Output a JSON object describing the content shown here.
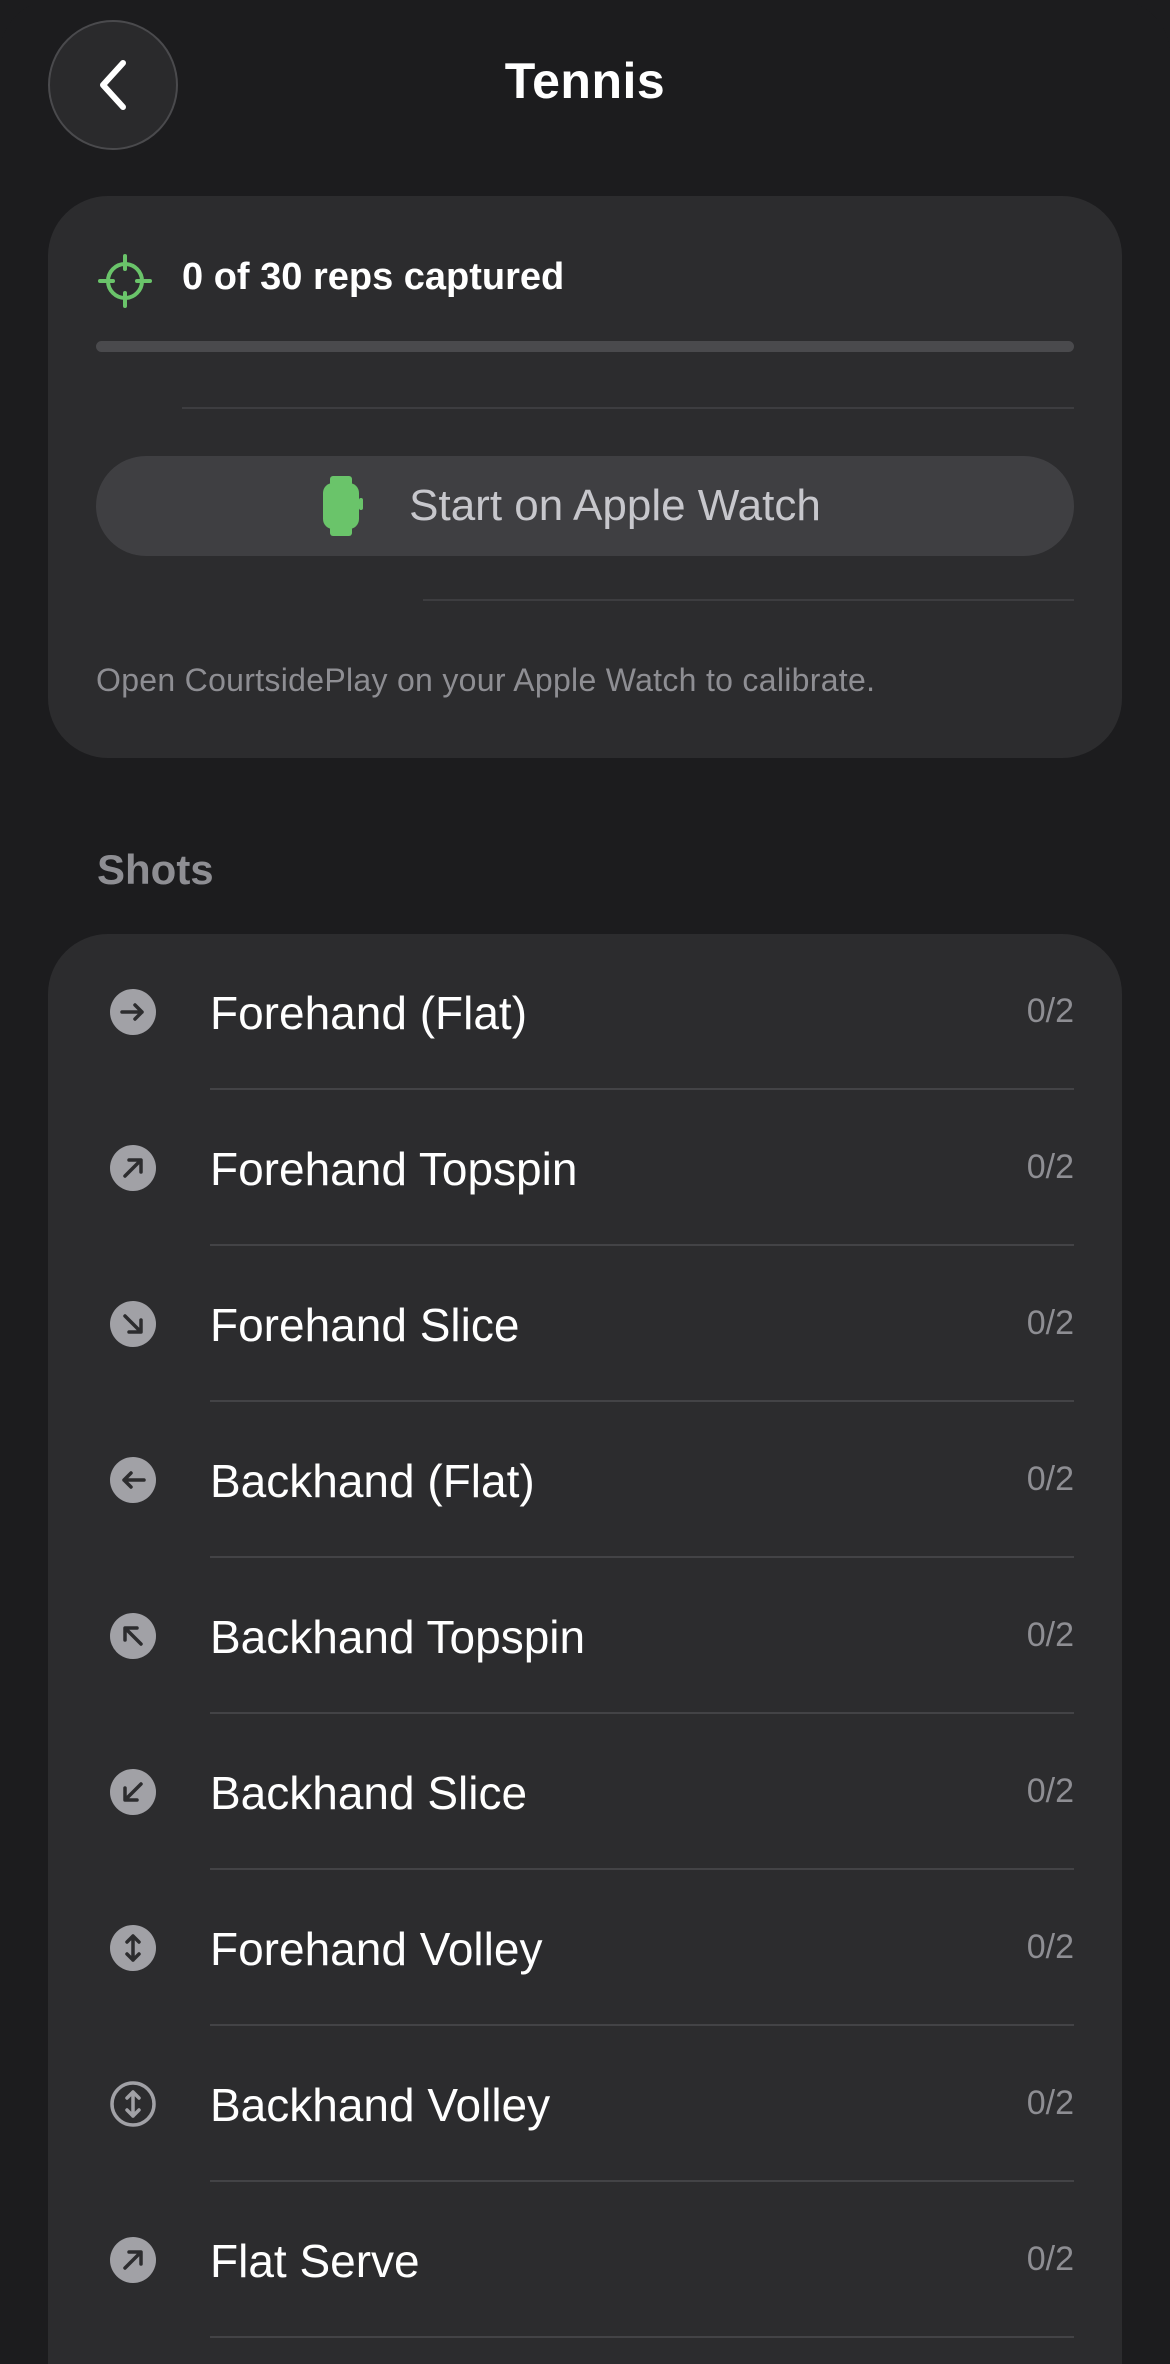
{
  "header": {
    "title": "Tennis",
    "back_icon": "chevron-left-icon"
  },
  "progress": {
    "reps_text": "0 of 30 reps captured",
    "captured": 0,
    "total": 30,
    "fraction": 0,
    "icon": "crosshair-icon",
    "accent_color": "#6ac46a"
  },
  "watch_button": {
    "label": "Start on Apple Watch",
    "icon": "apple-watch-icon"
  },
  "hint": "Open CourtsidePlay on your Apple Watch to calibrate.",
  "shots_section": {
    "title": "Shots",
    "items": [
      {
        "label": "Forehand (Flat)",
        "count": "0/2",
        "icon": "arrow-right-circle-icon"
      },
      {
        "label": "Forehand Topspin",
        "count": "0/2",
        "icon": "arrow-up-right-circle-icon"
      },
      {
        "label": "Forehand Slice",
        "count": "0/2",
        "icon": "arrow-down-right-circle-icon"
      },
      {
        "label": "Backhand (Flat)",
        "count": "0/2",
        "icon": "arrow-left-circle-icon"
      },
      {
        "label": "Backhand Topspin",
        "count": "0/2",
        "icon": "arrow-up-left-circle-icon"
      },
      {
        "label": "Backhand Slice",
        "count": "0/2",
        "icon": "arrow-down-left-circle-icon"
      },
      {
        "label": "Forehand Volley",
        "count": "0/2",
        "icon": "arrow-up-down-circle-icon"
      },
      {
        "label": "Backhand Volley",
        "count": "0/2",
        "icon": "arrow-up-down-circle-outline-icon"
      },
      {
        "label": "Flat Serve",
        "count": "0/2",
        "icon": "arrow-up-right-circle-icon"
      }
    ]
  }
}
